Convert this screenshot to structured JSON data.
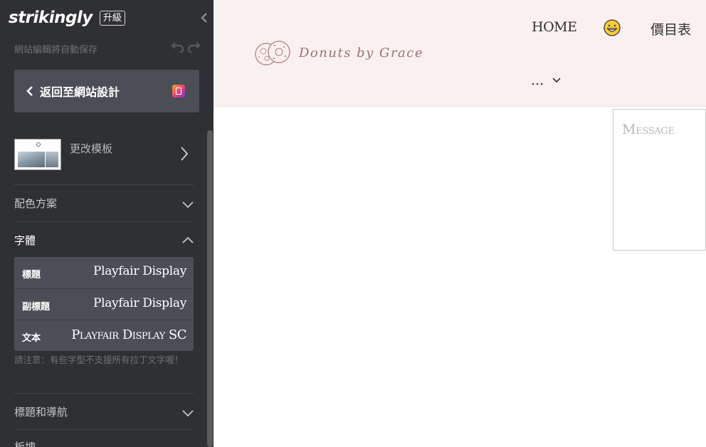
{
  "sidebar": {
    "logo": "strikingly",
    "upgrade_label": "升級",
    "autosave_text": "網站編輯將自動保存",
    "back_button_label": "返回至網站設計",
    "template": {
      "label": "更改模板"
    },
    "sections": {
      "color_scheme": "配色方案",
      "fonts": "字體",
      "header_nav": "標題和導航",
      "partial_next": "板塊"
    },
    "font_rows": [
      {
        "label": "標題",
        "value": "Playfair Display"
      },
      {
        "label": "副標題",
        "value": "Playfair Display"
      },
      {
        "label": "文本",
        "value": "Playfair Display SC"
      }
    ],
    "font_note": "請注意：有些字型不支援所有拉丁文字喔！"
  },
  "preview": {
    "site_name": "Donuts by Grace",
    "nav": {
      "home": "HOME",
      "pricing": "價目表",
      "more": "..."
    },
    "message_placeholder": "Message"
  },
  "colors": {
    "sidebar_bg": "#2f3033",
    "button_bg": "#4b4e55",
    "header_bg": "#fbf0f0",
    "site_name_color": "#9a7373"
  }
}
